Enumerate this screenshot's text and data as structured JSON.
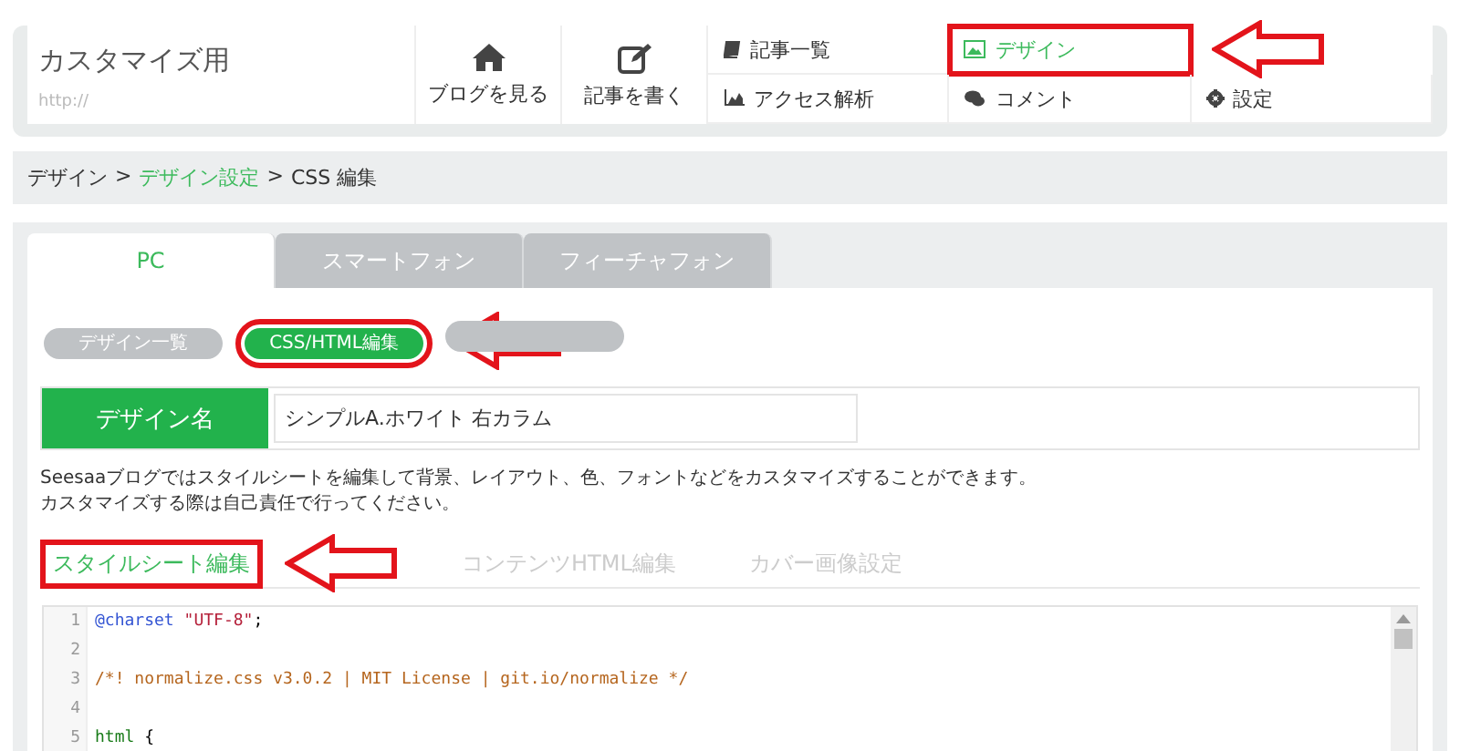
{
  "header": {
    "blog_title": "カスタマイズ用",
    "blog_url": "http://",
    "big_buttons": [
      {
        "label": "ブログを見る"
      },
      {
        "label": "記事を書く"
      }
    ],
    "menu_rows": [
      [
        {
          "label": "記事一覧",
          "selected": false,
          "highlighted": false
        },
        {
          "label": "デザイン",
          "selected": true,
          "highlighted": true
        }
      ],
      [
        {
          "label": "アクセス解析",
          "selected": false,
          "highlighted": false
        },
        {
          "label": "コメント",
          "selected": false,
          "highlighted": false
        },
        {
          "label": "設定",
          "selected": false,
          "highlighted": false
        }
      ]
    ]
  },
  "breadcrumb": [
    {
      "label": "デザイン",
      "kind": "text"
    },
    {
      "label": ">",
      "kind": "separator"
    },
    {
      "label": "デザイン設定",
      "kind": "link"
    },
    {
      "label": ">",
      "kind": "separator"
    },
    {
      "label": "CSS 編集",
      "kind": "text"
    }
  ],
  "device_tabs": [
    {
      "label": "PC",
      "selected": true
    },
    {
      "label": "スマートフォン",
      "selected": false
    },
    {
      "label": "フィーチャフォン",
      "selected": false
    }
  ],
  "pills": [
    {
      "label": "デザイン一覧",
      "selected": false,
      "highlighted": false
    },
    {
      "label": "CSS/HTML編集",
      "selected": true,
      "highlighted": true
    },
    {
      "selected": false,
      "highlighted": false
    }
  ],
  "design_name": {
    "label": "デザイン名",
    "value": "シンプルA.ホワイト 右カラム"
  },
  "description": [
    "Seesaaブログではスタイルシートを編集して背景、レイアウト、色、フォントなどをカスタマイズすることができます。",
    "カスタマイズする際は自己責任で行ってください。"
  ],
  "sub_tabs": [
    {
      "label": "スタイルシート編集",
      "selected": true,
      "highlighted": true
    },
    {
      "label": "コンテンツHTML編集",
      "selected": false,
      "highlighted": false
    },
    {
      "label": "カバー画像設定",
      "selected": false,
      "highlighted": false
    }
  ],
  "code_lines": [
    {
      "number": "1",
      "tokens": [
        {
          "text": "@charset",
          "kind": "keyword"
        },
        {
          "text": " \"UTF-8\"",
          "kind": "string"
        },
        {
          "text": ";",
          "kind": "plain"
        }
      ]
    },
    {
      "number": "2"
    },
    {
      "number": "3",
      "tokens": [
        {
          "text": "/*! normalize.css v3.0.2 | MIT License | git.io/normalize */",
          "kind": "comment"
        }
      ]
    },
    {
      "number": "4"
    },
    {
      "number": "5",
      "tokens": [
        {
          "text": "html",
          "kind": "tag"
        },
        {
          "text": " {",
          "kind": "plain"
        }
      ]
    }
  ]
}
